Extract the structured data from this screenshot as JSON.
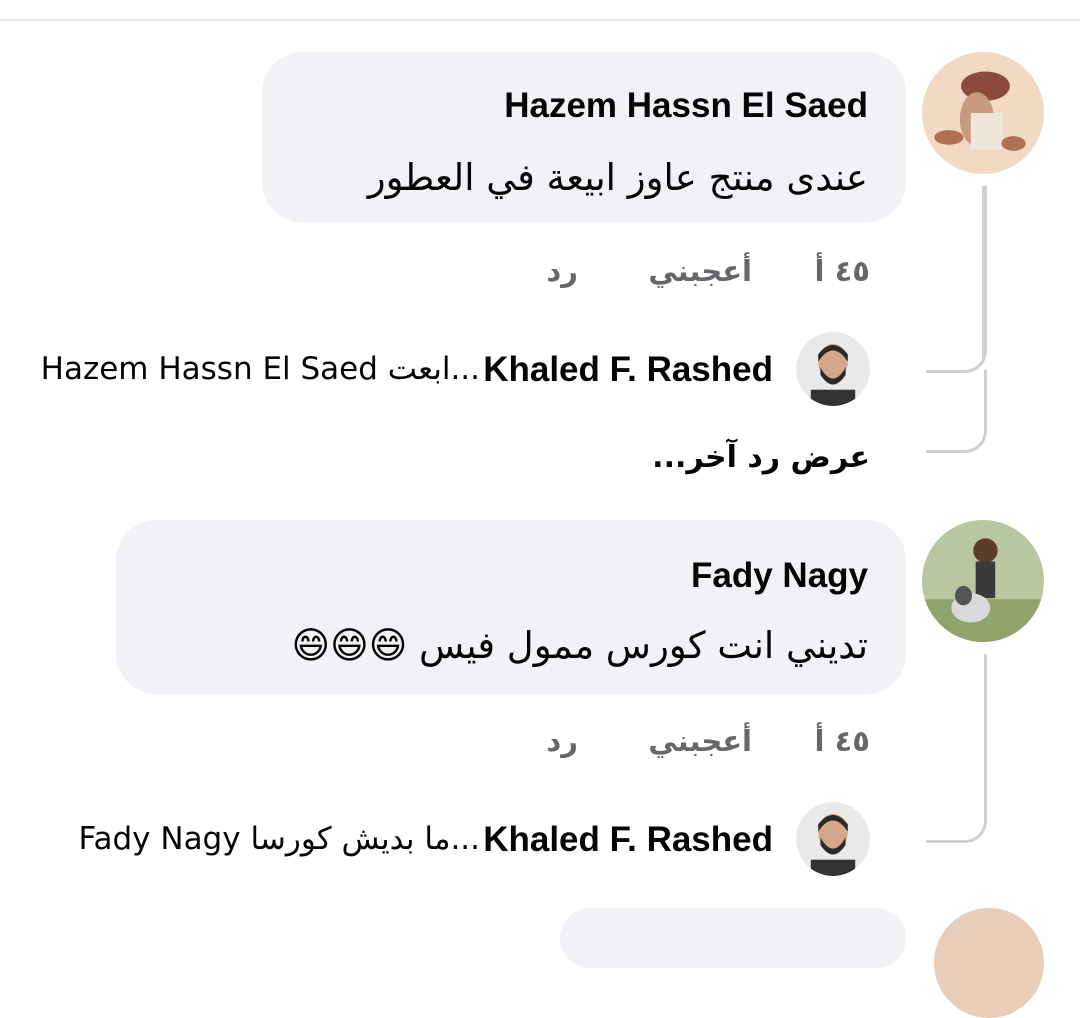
{
  "comments": [
    {
      "author": "Hazem Hassn El Saed",
      "text": "عندى منتج عاوز ابيعة في العطور",
      "time": "٤٥ أ",
      "like_label": "أعجبني",
      "reply_label": "رد",
      "reply": {
        "author": "Khaled F. Rashed",
        "snippet": "Hazem Hassn El Saed ابعت..."
      },
      "view_more": "عرض رد آخر..."
    },
    {
      "author": "Fady Nagy",
      "text": "تديني انت كورس ممول فيس 😄😄😄",
      "time": "٤٥ أ",
      "like_label": "أعجبني",
      "reply_label": "رد",
      "reply": {
        "author": "Khaled F. Rashed",
        "snippet": "Fady Nagy ما بديش كورسا..."
      }
    }
  ],
  "colors": {
    "bubble": "#f0f2f5",
    "meta_text": "#65676b",
    "thread_line": "#ced0d4",
    "emoji": "#f7c02a"
  }
}
